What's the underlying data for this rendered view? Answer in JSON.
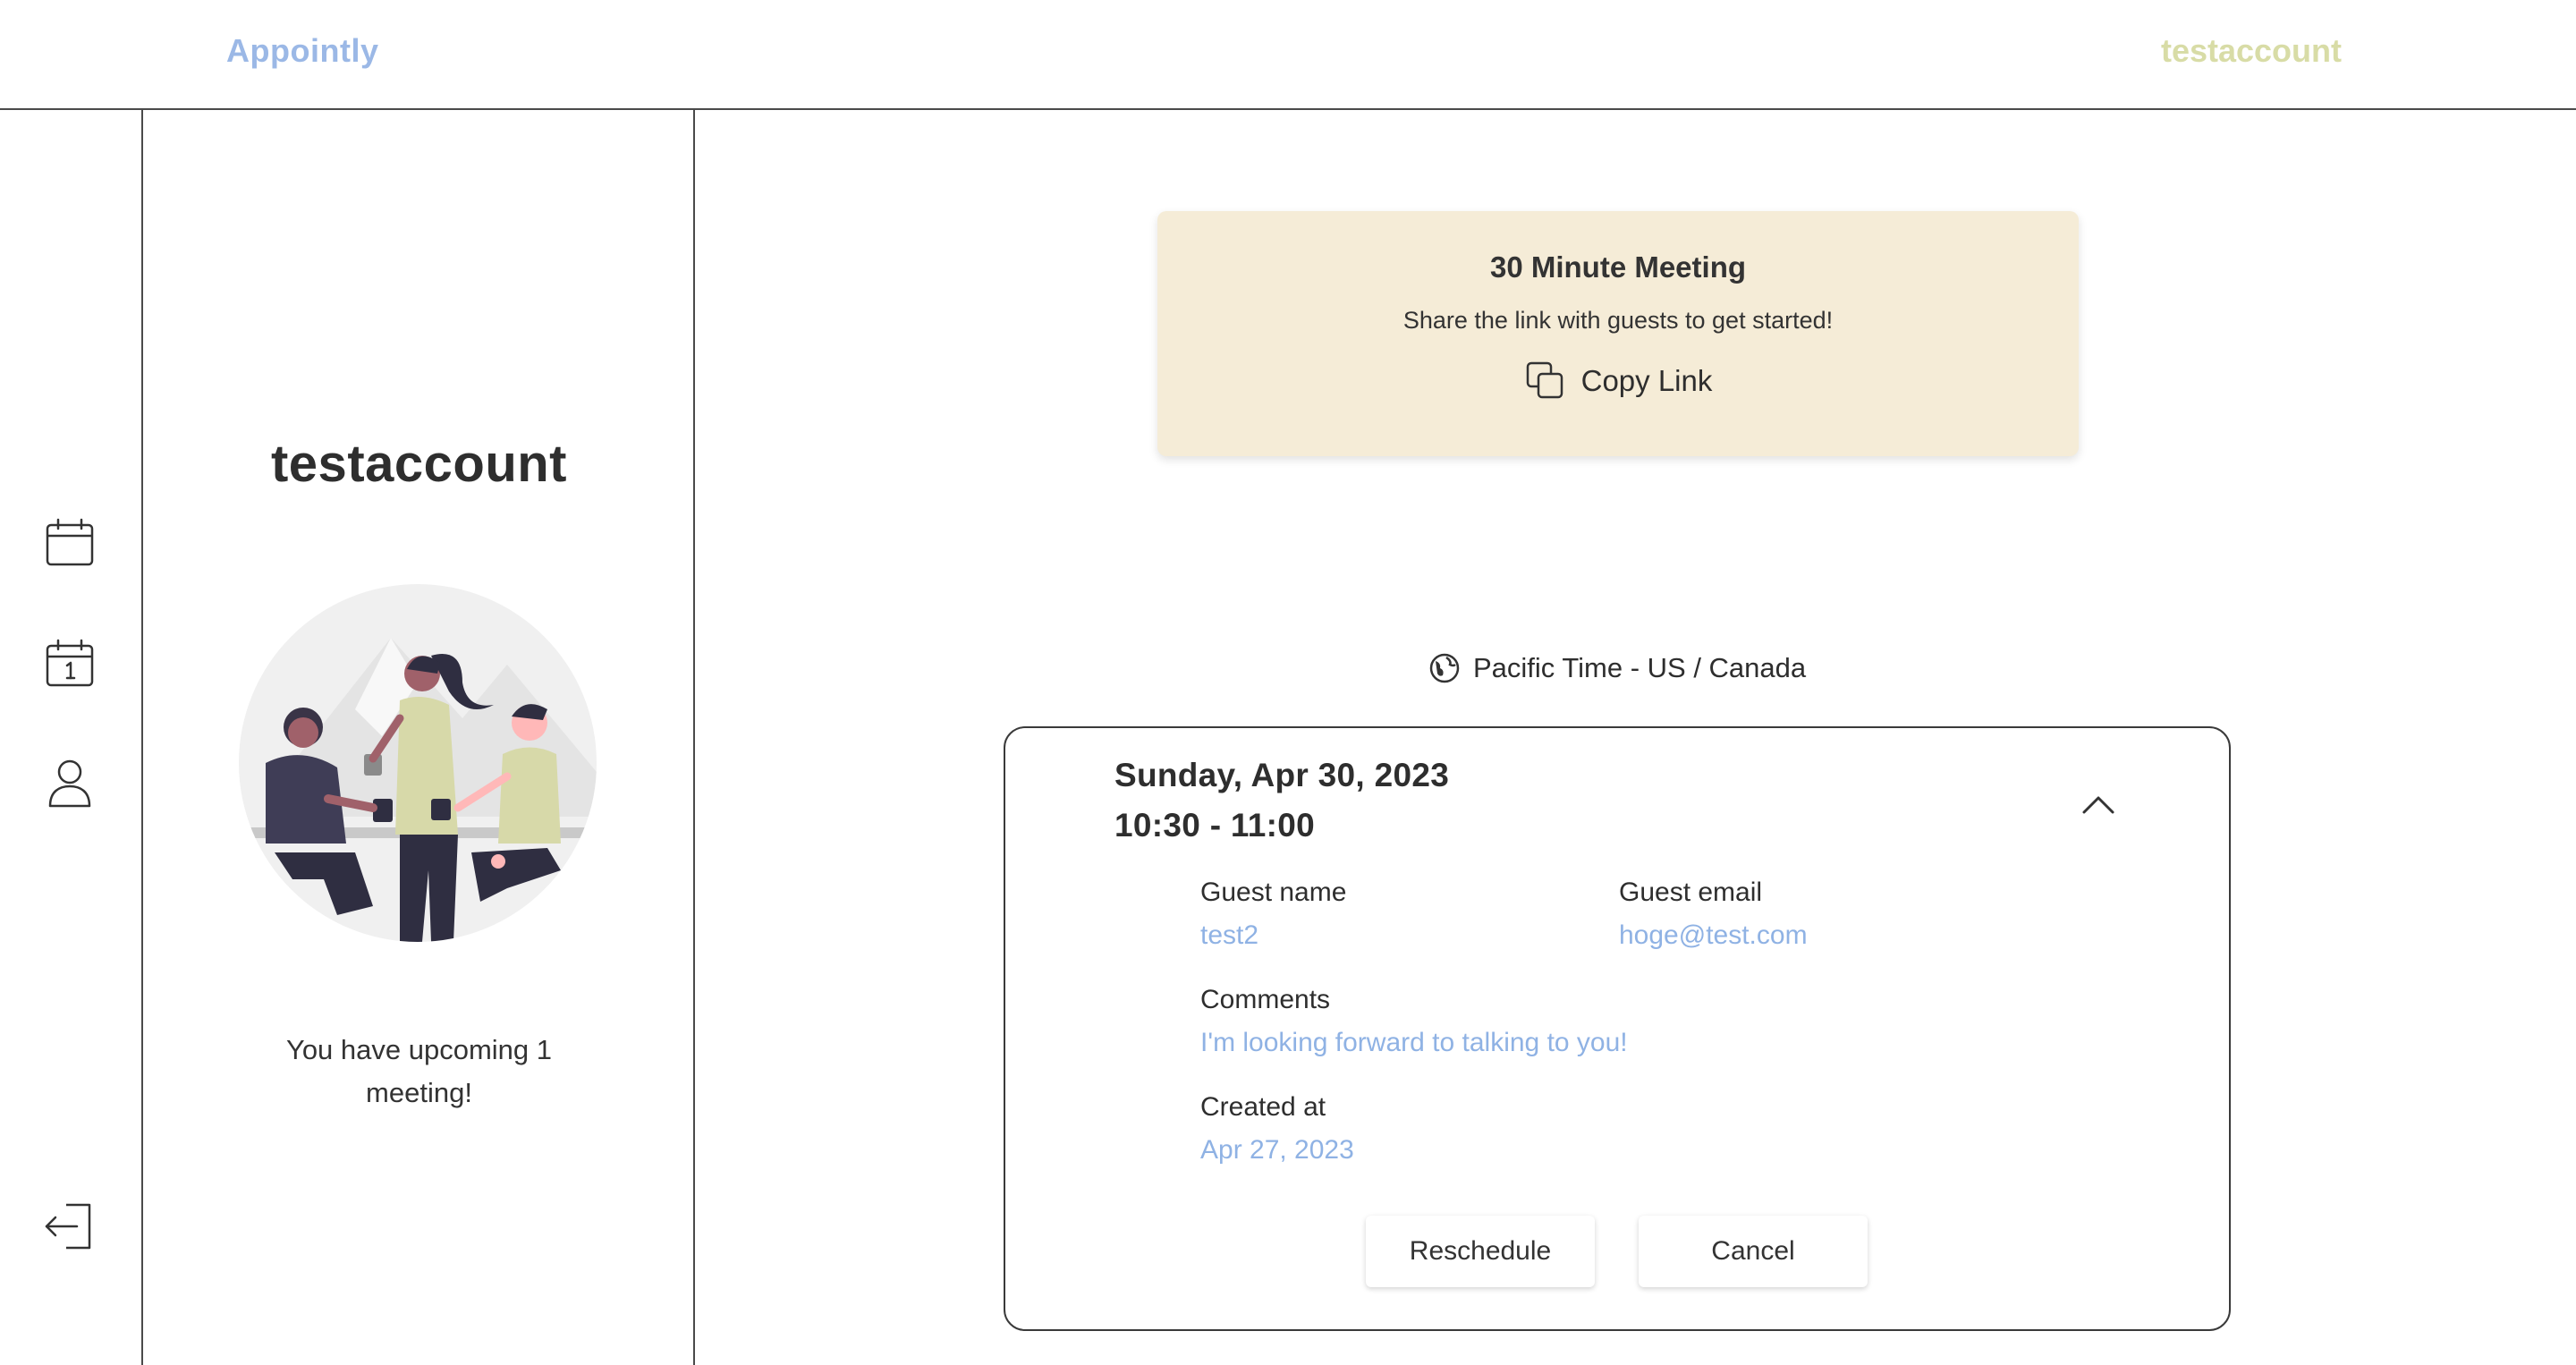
{
  "header": {
    "brand": "Appointly",
    "username": "testaccount"
  },
  "rail": {
    "items": [
      {
        "icon": "calendar-icon"
      },
      {
        "icon": "calendar-day-icon"
      },
      {
        "icon": "user-icon"
      },
      {
        "icon": "logout-icon"
      }
    ]
  },
  "profile": {
    "name": "testaccount",
    "upcoming_text": "You have upcoming 1 meeting!"
  },
  "share_card": {
    "title": "30 Minute Meeting",
    "subtitle": "Share the link with guests to get started!",
    "copy_label": "Copy Link"
  },
  "timezone": {
    "label": "Pacific Time - US / Canada"
  },
  "meeting": {
    "date": "Sunday, Apr 30, 2023",
    "time": "10:30 - 11:00",
    "guest_name_label": "Guest name",
    "guest_name": "test2",
    "guest_email_label": "Guest email",
    "guest_email": "hoge@test.com",
    "comments_label": "Comments",
    "comments": "I'm looking forward to talking to you!",
    "created_label": "Created at",
    "created": "Apr 27, 2023",
    "reschedule_label": "Reschedule",
    "cancel_label": "Cancel"
  },
  "colors": {
    "brand": "#9bb8e6",
    "username": "#d8dca6",
    "share_card_bg": "#f5ecd7",
    "value_text": "#8fb2e4",
    "border": "#4a4a4a"
  }
}
